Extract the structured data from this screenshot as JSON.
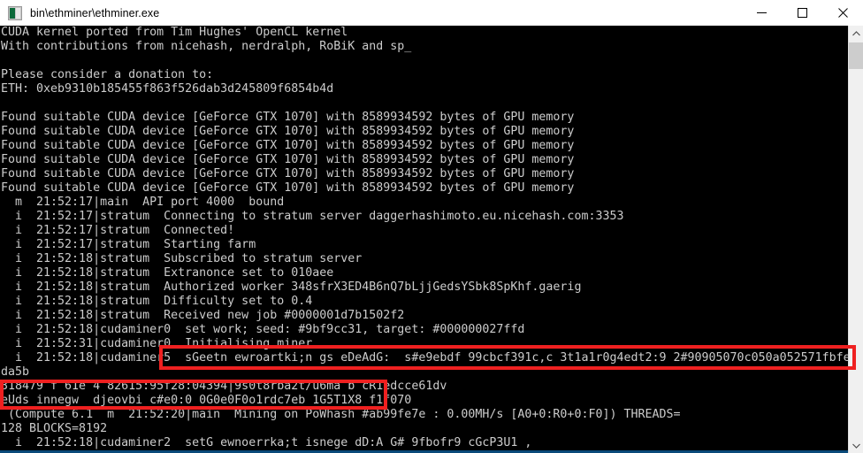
{
  "window": {
    "title": "bin\\ethminer\\ethminer.exe",
    "icon": "console-app-icon",
    "controls": [
      {
        "name": "minimize-button",
        "glyph": "minimize-icon",
        "label": "Minimize"
      },
      {
        "name": "maximize-button",
        "glyph": "maximize-icon",
        "label": "Maximize"
      },
      {
        "name": "close-button",
        "glyph": "close-icon",
        "label": "Close"
      }
    ]
  },
  "terminal": {
    "foreground_color": "#cccccc",
    "background_color": "#000000",
    "lines": [
      "CUDA kernel ported from Tim Hughes' OpenCL kernel",
      "With contributions from nicehash, nerdralph, RoBiK and sp_",
      "",
      "Please consider a donation to:",
      "ETH: 0xeb9310b185455f863f526dab3d245809f6854b4d",
      "",
      "Found suitable CUDA device [GeForce GTX 1070] with 8589934592 bytes of GPU memory",
      "Found suitable CUDA device [GeForce GTX 1070] with 8589934592 bytes of GPU memory",
      "Found suitable CUDA device [GeForce GTX 1070] with 8589934592 bytes of GPU memory",
      "Found suitable CUDA device [GeForce GTX 1070] with 8589934592 bytes of GPU memory",
      "Found suitable CUDA device [GeForce GTX 1070] with 8589934592 bytes of GPU memory",
      "Found suitable CUDA device [GeForce GTX 1070] with 8589934592 bytes of GPU memory",
      "  m  21:52:17|main  API port 4000  bound",
      "  i  21:52:17|stratum  Connecting to stratum server daggerhashimoto.eu.nicehash.com:3353",
      "  i  21:52:17|stratum  Connected!",
      "  i  21:52:17|stratum  Starting farm",
      "  i  21:52:18|stratum  Subscribed to stratum server",
      "  i  21:52:18|stratum  Extranonce set to 010aee",
      "  i  21:52:18|stratum  Authorized worker 348sfrX3ED4B6nQ7bLjjGedsYSbk8SpKhf.gaerig",
      "  i  21:52:18|stratum  Difficulty set to 0.4",
      "  i  21:52:18|stratum  Received new job #0000001d7b1502f2",
      "  i  21:52:18|cudaminer0  set work; seed: #9bf9cc31, target: #000000027ffd",
      "  i  21:52:31|cudaminer0  Initialising miner",
      "  i  21:52:18|cudaminer5  sGeetn ewroartki;n gs eDeAdG:  s#e9ebdf 99cbcf391c,c 3t1a1r0g4edt2:9 2#90905070c050a052571fbfe",
      "da5b",
      "318479 f 61e 4 82615:95f28:04394|9s0t8rba2t/u6ma b cR1edcce61dv",
      "eUds innegw  djeovbi c#e0:0 0G0e0F0o1rdc7eb 1G5T1X8 f1f070",
      " (Compute 6.1  m  21:52:20|main  Mining on PoWhash #ab99fe7e : 0.00MH/s [A0+0:R0+0:F0]) THREADS=",
      "128 BLOCKS=8192",
      "  i  21:52:18|cudaminer2  setG ewnoerrka;t isnege dD:A G# 9fbofr9 cGcP3U1 ,"
    ]
  },
  "scrollbar": {
    "up_arrow": "chevron-up-icon",
    "down_arrow": "chevron-down-icon",
    "thumb": "scrollbar-thumb"
  },
  "annotations": {
    "color": "#ef2020",
    "boxes": [
      {
        "name": "highlight-box-garbled-line-1"
      },
      {
        "name": "highlight-box-garbled-line-2"
      }
    ]
  }
}
